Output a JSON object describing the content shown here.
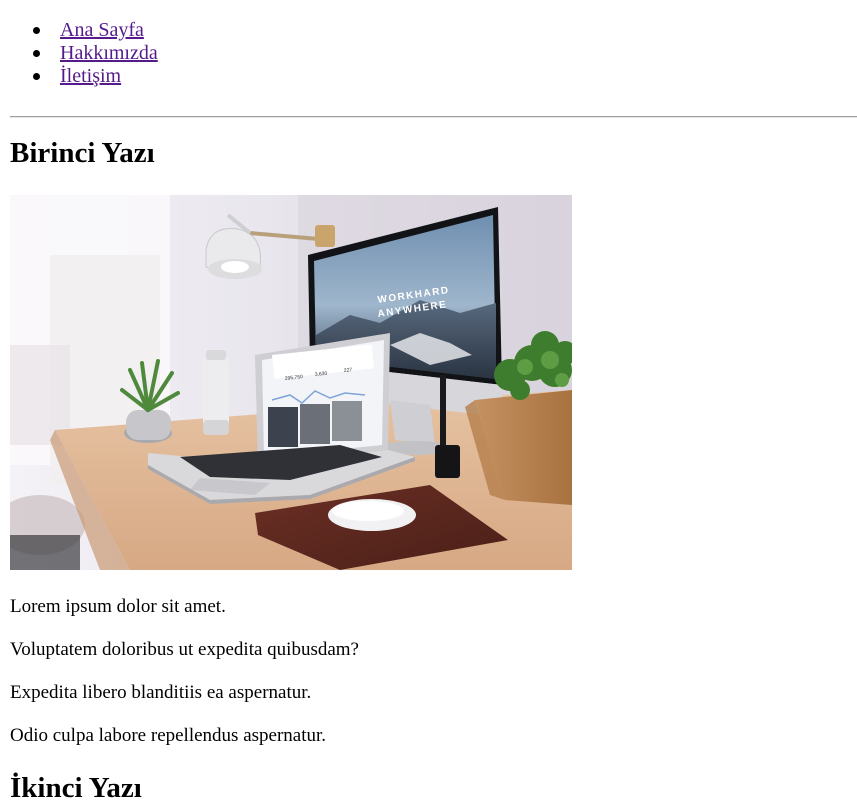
{
  "nav": {
    "items": [
      {
        "label": "Ana Sayfa"
      },
      {
        "label": "Hakkımızda"
      },
      {
        "label": "İletişim"
      }
    ],
    "link_color": "#551a8b"
  },
  "posts": [
    {
      "title": "Birinci Yazı",
      "image": {
        "screen_text_line1": "WORKHARD",
        "screen_text_line2": "ANYWHERE",
        "laptop_stats": [
          "295,750",
          "3,630",
          "227"
        ]
      },
      "paragraphs": [
        "Lorem ipsum dolor sit amet.",
        "Voluptatem doloribus ut expedita quibusdam?",
        "Expedita libero blanditiis ea aspernatur.",
        "Odio culpa labore repellendus aspernatur."
      ]
    },
    {
      "title": "İkinci Yazı"
    }
  ]
}
